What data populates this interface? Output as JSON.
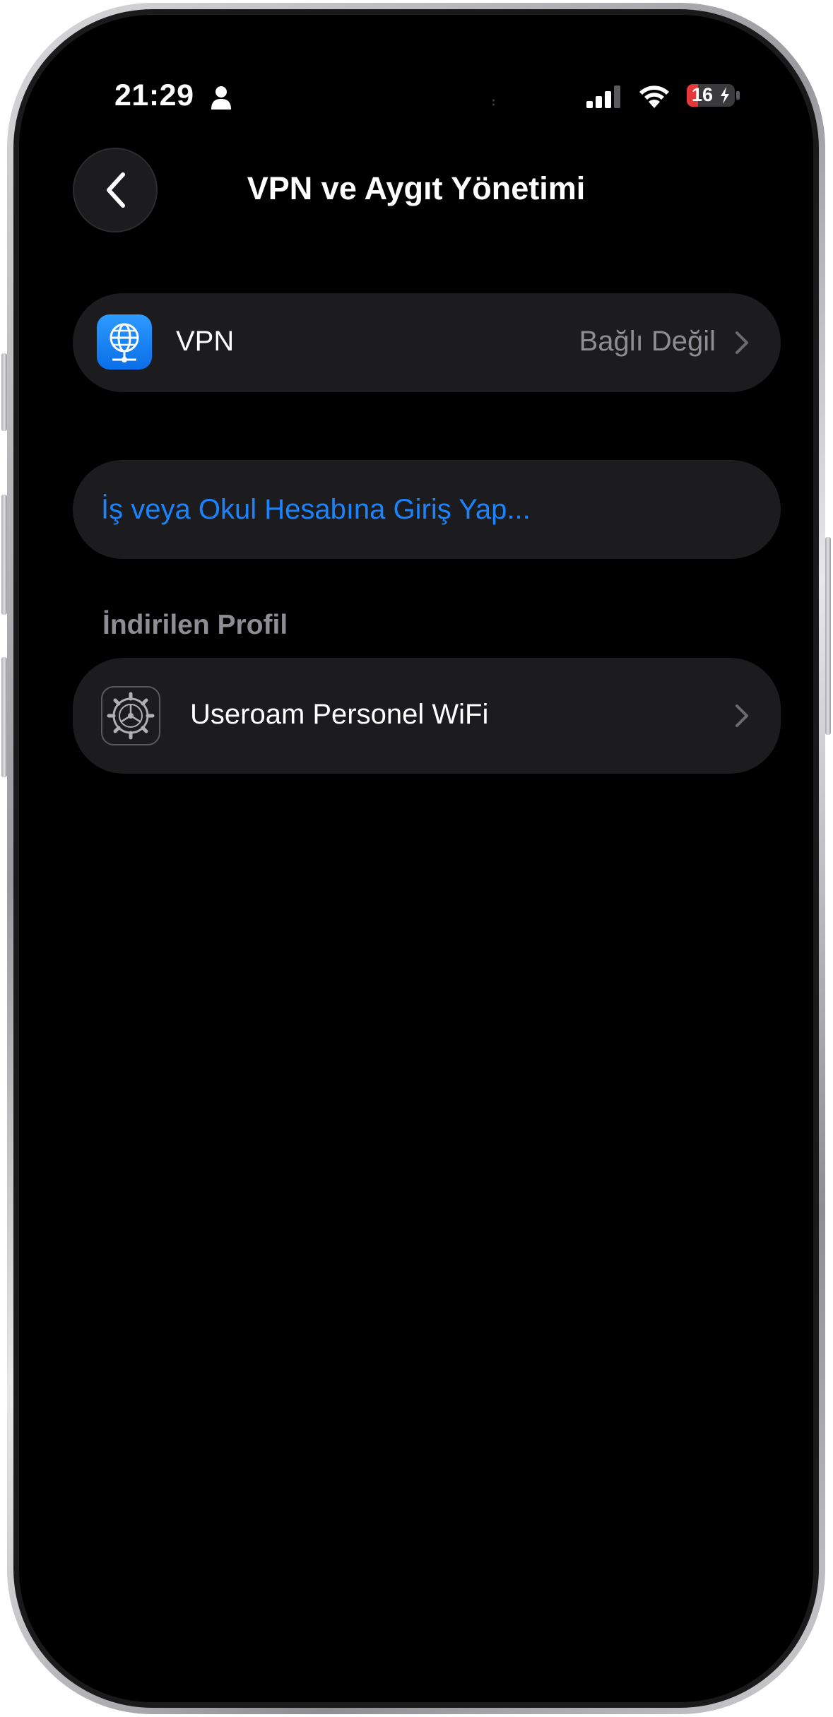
{
  "status_bar": {
    "time": "21:29",
    "battery": "16",
    "person_icon": "person-icon",
    "signal_icon": "cellular-signal-icon",
    "wifi_icon": "wifi-icon",
    "battery_icon": "battery-charging-icon",
    "battery_color": "#e5383b"
  },
  "header": {
    "back_icon": "chevron-left-icon",
    "title": "VPN ve Aygıt Yönetimi"
  },
  "vpn_row": {
    "icon": "globe-network-icon",
    "label": "VPN",
    "status": "Bağlı Değil",
    "chevron_icon": "chevron-right-icon"
  },
  "signin_row": {
    "label": "İş veya Okul Hesabına Giriş Yap..."
  },
  "downloaded_profile": {
    "section_title": "İndirilen Profil",
    "icon": "settings-gear-icon",
    "label": "Useroam Personel WiFi",
    "chevron_icon": "chevron-right-icon"
  },
  "colors": {
    "background": "#000000",
    "card": "#1c1c1e",
    "accent": "#1a84ff",
    "secondary_text": "#8d8d93"
  }
}
